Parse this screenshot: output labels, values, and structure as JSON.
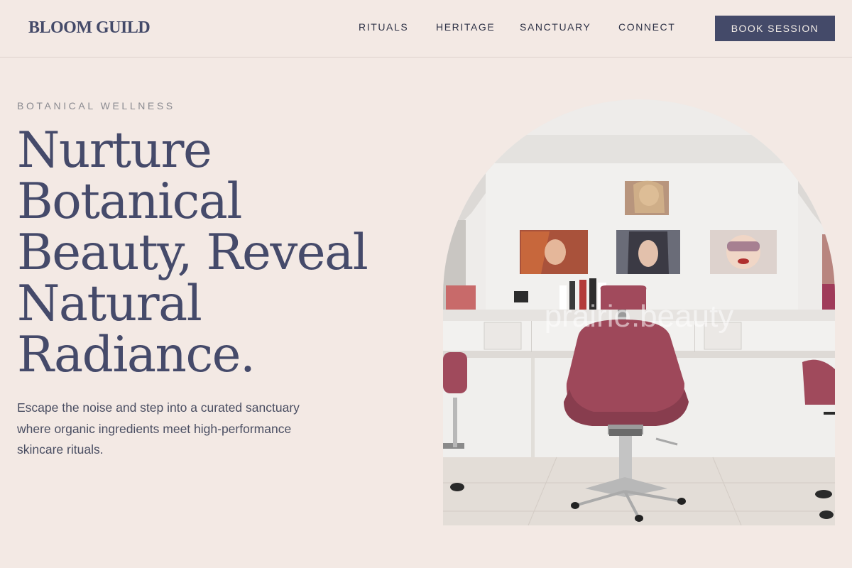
{
  "brand": {
    "logo": "BLOOM GUILD"
  },
  "nav": {
    "items": [
      {
        "label": "RITUALS"
      },
      {
        "label": "HERITAGE"
      },
      {
        "label": "SANCTUARY"
      },
      {
        "label": "CONNECT"
      }
    ],
    "cta_label": "BOOK SESSION"
  },
  "hero": {
    "eyebrow": "BOTANICAL WELLNESS",
    "headline": "Nurture Botanical Beauty, Reveal Natural Radiance.",
    "description": "Escape the noise and step into a curated sanctuary where organic ingredients meet high-performance skincare rituals.",
    "image_watermark": "prairie.beauty"
  },
  "colors": {
    "background": "#f3e9e4",
    "accent": "#444a69",
    "chair": "#a04a5c"
  }
}
